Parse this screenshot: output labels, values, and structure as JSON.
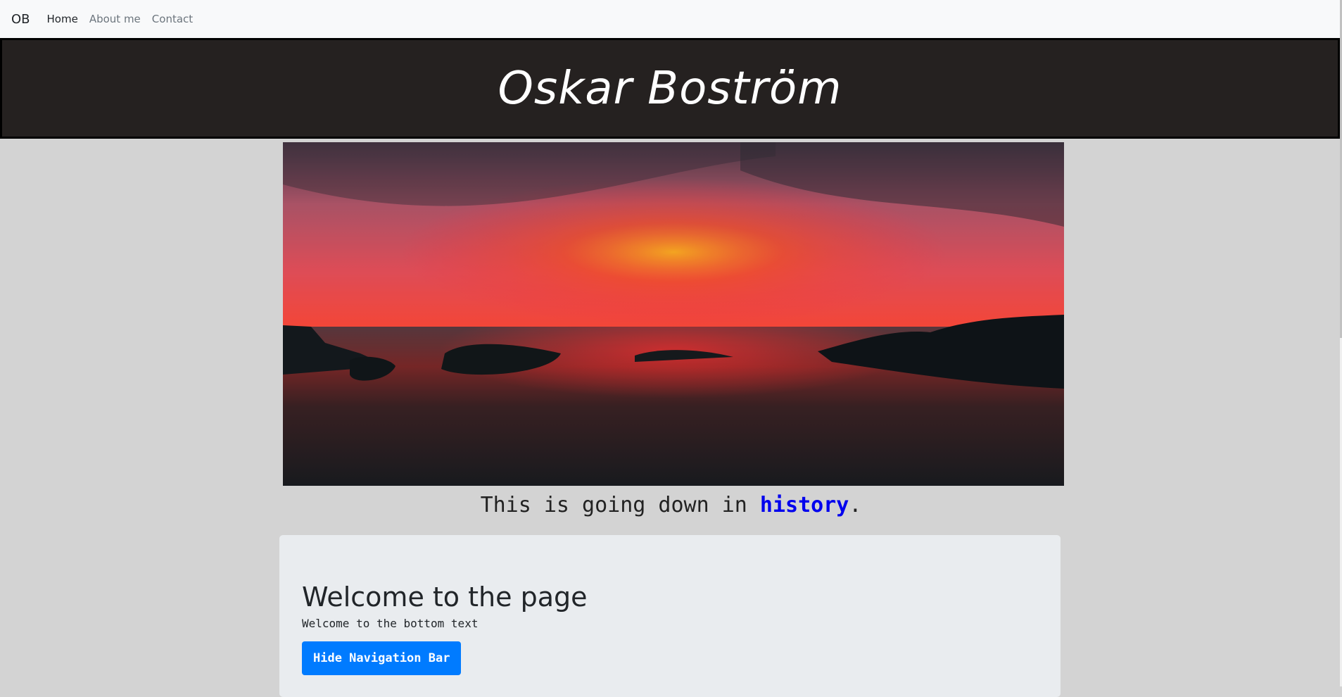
{
  "navbar": {
    "brand": "OB",
    "links": [
      {
        "label": "Home",
        "active": true
      },
      {
        "label": "About me",
        "active": false
      },
      {
        "label": "Contact",
        "active": false
      }
    ]
  },
  "header": {
    "title": "Oskar Boström"
  },
  "caption": {
    "before": "This is going down in ",
    "highlight": "history",
    "after": "."
  },
  "jumbotron": {
    "heading": "Welcome to the page",
    "text": "Welcome to the bottom text",
    "button_label": "Hide Navigation Bar"
  },
  "colors": {
    "header_bg": "#252120",
    "page_bg": "#d3d3d3",
    "button_bg": "#007bff",
    "link_highlight": "#0000ee"
  }
}
